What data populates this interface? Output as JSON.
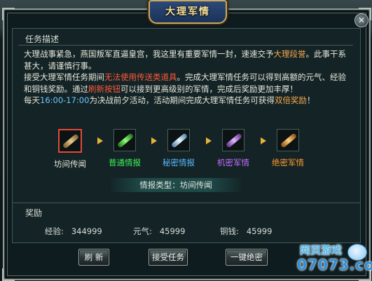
{
  "dialog": {
    "title": "大理军情",
    "close_glyph": "✕"
  },
  "task": {
    "section_title": "任务描述",
    "p1": "大理战事紧急，燕国叛军直逼皇宫，我这里有重要军情一封，速速交予",
    "p1_highlight": "大理段誉",
    "p1_end": "。此事干系甚大，请谨慎行事。",
    "p2_a": "接受大理军情任务期间",
    "p2_red": "无法使用传送类道具",
    "p2_b": "。完成大理军情任务可以得到高额的元气、经验和铜钱奖励。通过",
    "p2_red2": "刷新按钮",
    "p2_c": "可以接到更高级别的军情，完成后奖励更加丰厚！",
    "p3_a": "每天",
    "p3_time": "16:00-17:00",
    "p3_b": "为决战前夕活动，活动期间完成大理军情任务可获得",
    "p3_highlight": "双倍奖励",
    "p3_end": "！"
  },
  "stages": [
    {
      "label": "坊间传闻",
      "color": "#d9d9c8",
      "scroll_color": "#c4a46a",
      "active": true
    },
    {
      "label": "普通情报",
      "color": "#3df05a",
      "scroll_color": "#4bdf3f",
      "active": false
    },
    {
      "label": "秘密情报",
      "color": "#58b8ff",
      "scroll_color": "#9ed8ff",
      "active": false
    },
    {
      "label": "机密军情",
      "color": "#c56bff",
      "scroll_color": "#b46ae0",
      "active": false
    },
    {
      "label": "绝密军情",
      "color": "#ff9a2e",
      "scroll_color": "#ff9f3a",
      "active": false
    }
  ],
  "intel_type": {
    "label": "情报类型：",
    "value": "坊间传闻"
  },
  "reward": {
    "section_title": "奖励",
    "exp_label": "经验:",
    "exp_value": "344999",
    "qi_label": "元气:",
    "qi_value": "45999",
    "copper_label": "铜钱:",
    "copper_value": "45999"
  },
  "buttons": {
    "refresh": "刷  新",
    "accept": "接受任务",
    "one_click": "一键绝密"
  },
  "watermark": {
    "top": "网页游戏",
    "bottom": "07073.com"
  },
  "colors": {
    "accent_gold": "#e7b239",
    "active_border": "#e34a37"
  }
}
